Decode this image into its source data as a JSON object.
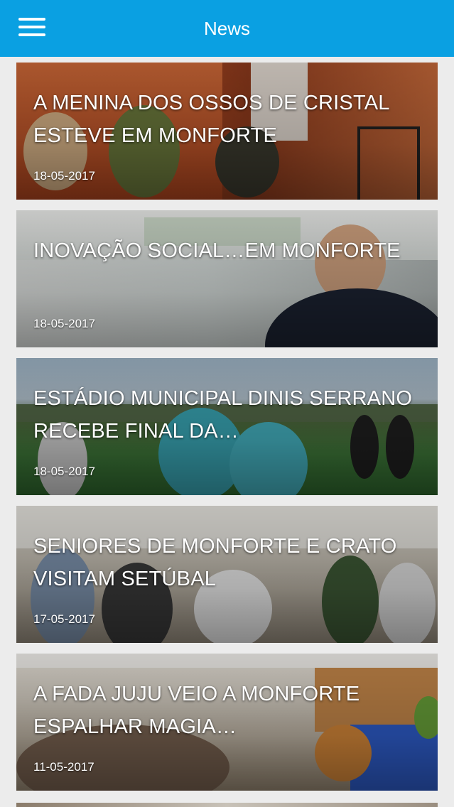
{
  "header": {
    "title": "News",
    "menu_icon": "hamburger-menu-icon",
    "background_color": "#0aa0e2"
  },
  "articles": [
    {
      "title": "A MENINA DOS OSSOS DE CRISTAL ESTEVE EM MONFORTE",
      "date": "18-05-2017"
    },
    {
      "title": "INOVAÇÃO SOCIAL…EM MONFORTE",
      "date": "18-05-2017"
    },
    {
      "title": "ESTÁDIO MUNICIPAL DINIS SERRANO RECEBE FINAL DA…",
      "date": "18-05-2017"
    },
    {
      "title": "SENIORES DE MONFORTE E CRATO VISITAM SETÚBAL",
      "date": "17-05-2017"
    },
    {
      "title": "A FADA JUJU VEIO A MONFORTE ESPALHAR MAGIA…",
      "date": "11-05-2017"
    }
  ]
}
